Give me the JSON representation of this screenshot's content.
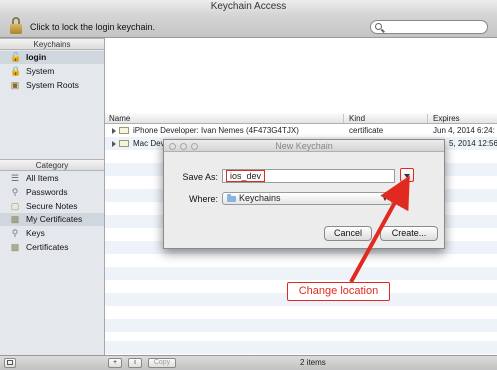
{
  "window": {
    "title": "Keychain Access"
  },
  "toolbar": {
    "lock_text": "Click to lock the login keychain."
  },
  "sidebar": {
    "keychains_header": "Keychains",
    "keychains": [
      {
        "label": "login",
        "icon": "lock-icon",
        "selected": true
      },
      {
        "label": "System",
        "icon": "lock-icon",
        "selected": false
      },
      {
        "label": "System Roots",
        "icon": "cabinet-icon",
        "selected": false
      }
    ],
    "category_header": "Category",
    "categories": [
      {
        "label": "All Items",
        "icon": "all-items-icon",
        "selected": false
      },
      {
        "label": "Passwords",
        "icon": "key-icon",
        "selected": false
      },
      {
        "label": "Secure Notes",
        "icon": "note-icon",
        "selected": false
      },
      {
        "label": "My Certificates",
        "icon": "certificate-icon",
        "selected": true
      },
      {
        "label": "Keys",
        "icon": "key-icon",
        "selected": false
      },
      {
        "label": "Certificates",
        "icon": "certificate-icon",
        "selected": false
      }
    ]
  },
  "table": {
    "columns": [
      "Name",
      "Kind",
      "Expires"
    ],
    "rows": [
      {
        "name": "iPhone Developer: Ivan Nemes (4F473G4TJX)",
        "kind": "certificate",
        "expires": "Jun 4, 2014 6:24:"
      },
      {
        "name": "Mac Dev",
        "kind": "",
        "expires": "5, 2014 12:56:"
      }
    ]
  },
  "bottombar": {
    "add_label": "+",
    "info_label": "i",
    "copy_label": "Copy",
    "items_count": "2 items"
  },
  "dialog": {
    "title": "New Keychain",
    "save_as_label": "Save As:",
    "save_as_value": "ios_dev",
    "where_label": "Where:",
    "where_value": "Keychains",
    "cancel_label": "Cancel",
    "create_label": "Create..."
  },
  "annotation": {
    "text": "Change location",
    "color": "#e02a20"
  }
}
